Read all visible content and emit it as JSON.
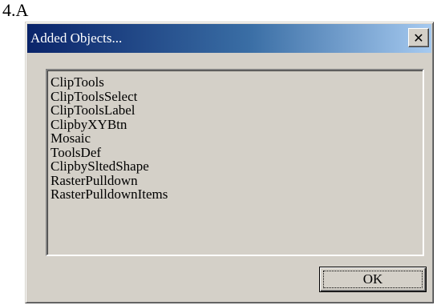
{
  "page": {
    "label": "4.A"
  },
  "dialog": {
    "title": "Added Objects...",
    "close_glyph": "✕",
    "items": [
      "ClipTools",
      "ClipToolsSelect",
      "ClipToolsLabel",
      "ClipbyXYBtn",
      "Mosaic",
      "ToolsDef",
      "ClipbySltedShape",
      "RasterPulldown",
      "RasterPulldownItems"
    ],
    "ok_label": "OK"
  },
  "colors": {
    "face": "#d4d0c8",
    "titlebar_start": "#0a246a",
    "titlebar_end": "#a6caf0"
  }
}
